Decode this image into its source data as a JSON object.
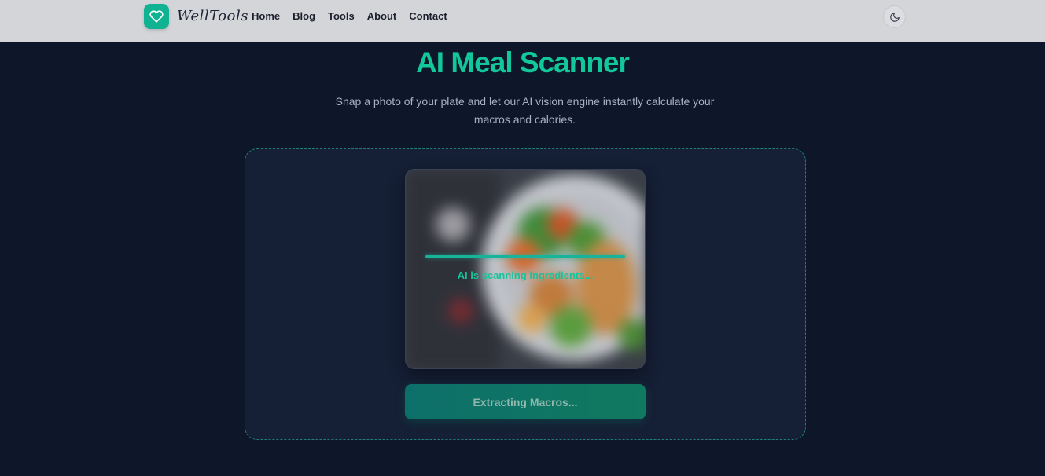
{
  "brand": {
    "name": "WellTools",
    "logo_icon": "heart-icon",
    "accent_color": "#10b391"
  },
  "nav": {
    "items": [
      {
        "label": "Home"
      },
      {
        "label": "Blog"
      },
      {
        "label": "Tools"
      },
      {
        "label": "About"
      },
      {
        "label": "Contact"
      }
    ],
    "theme_toggle_icon": "moon-icon"
  },
  "hero": {
    "title": "AI Meal Scanner",
    "subtitle": "Snap a photo of your plate and let our AI vision engine instantly calculate your macros and calories."
  },
  "scanner": {
    "status_text": "AI is scanning ingredients...",
    "button_label": "Extracting Macros..."
  }
}
